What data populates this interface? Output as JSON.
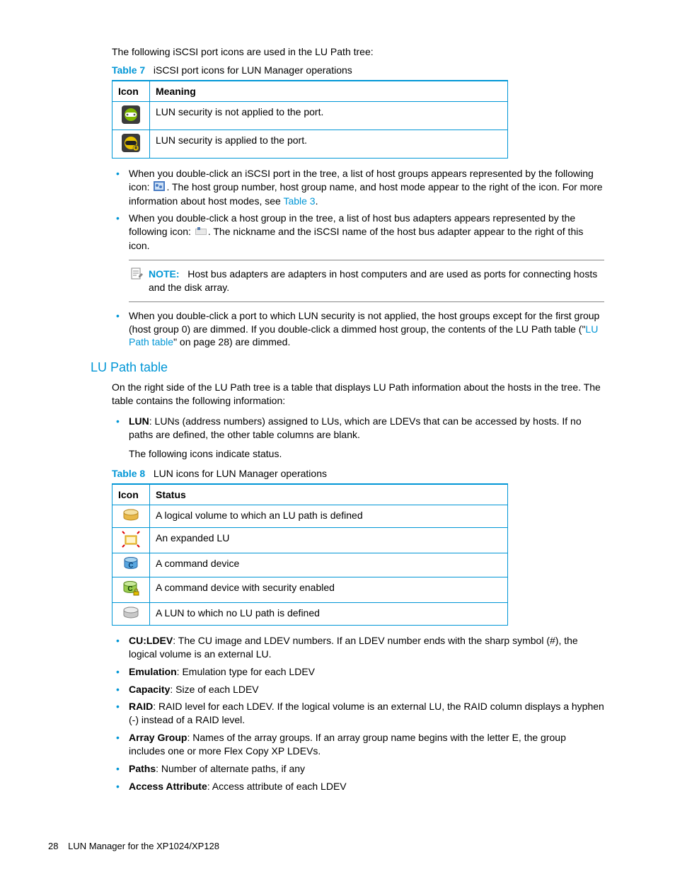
{
  "intro": "The following iSCSI port icons are used in the LU Path tree:",
  "table7": {
    "label": "Table 7",
    "title": "iSCSI port icons for LUN Manager operations",
    "headers": {
      "icon": "Icon",
      "meaning": "Meaning"
    },
    "rows": [
      {
        "meaning": "LUN security is not applied to the port."
      },
      {
        "meaning": "LUN security is applied to the port."
      }
    ]
  },
  "bullets1": {
    "b1a": "When you double-click an iSCSI port in the tree, a list of host groups appears represented by the following icon: ",
    "b1b": ". The host group number, host group name, and host mode appear to the right of the icon. For more information about host modes, see ",
    "b1link": "Table 3",
    "b2a": "When you double-click a host group in the tree, a list of host bus adapters appears represented by the following icon: ",
    "b2b": ". The nickname and the iSCSI name of the host bus adapter appear to the right of this icon."
  },
  "note": {
    "label": "NOTE:",
    "text": "Host bus adapters are adapters in host computers and are used as ports for connecting hosts and the disk array."
  },
  "bullets2": {
    "text1": "When you double-click a port to which LUN security is not applied, the host groups except for the first group (host group 0) are dimmed. If you double-click a dimmed host group, the contents of the LU Path table (\"",
    "link": "LU Path table",
    "text2": "\" on page 28) are dimmed."
  },
  "section": "LU Path table",
  "sectionP1": "On the right side of the LU Path tree is a table that displays LU Path information about the hosts in the tree. The table contains the following information:",
  "lun": {
    "term": "LUN",
    "desc": ": LUNs (address numbers) assigned to LUs, which are LDEVs that can be accessed by hosts. If no paths are defined, the other table columns are blank.",
    "after": "The following icons indicate status."
  },
  "table8": {
    "label": "Table 8",
    "title": "LUN icons for LUN Manager operations",
    "headers": {
      "icon": "Icon",
      "status": "Status"
    },
    "rows": [
      {
        "status": "A logical volume to which an LU path is defined"
      },
      {
        "status": "An expanded LU"
      },
      {
        "status": "A command device"
      },
      {
        "status": "A command device with security enabled"
      },
      {
        "status": "A LUN to which no LU path is defined"
      }
    ]
  },
  "defs": {
    "culdev": {
      "term": "CU:LDEV",
      "desc": ": The CU image and LDEV numbers. If an LDEV number ends with the sharp symbol (#), the logical volume is an external LU."
    },
    "emu": {
      "term": "Emulation",
      "desc": ": Emulation type for each LDEV"
    },
    "cap": {
      "term": "Capacity",
      "desc": ": Size of each LDEV"
    },
    "raid": {
      "term": "RAID",
      "desc": ": RAID level for each LDEV. If the logical volume is an external LU, the RAID column displays a hyphen (-) instead of a RAID level."
    },
    "ag": {
      "term": "Array Group",
      "desc": ": Names of the array groups. If an array group name begins with the letter E, the group includes one or more Flex Copy XP LDEVs."
    },
    "paths": {
      "term": "Paths",
      "desc": ": Number of alternate paths, if any"
    },
    "aa": {
      "term": "Access Attribute",
      "desc": ": Access attribute of each LDEV"
    }
  },
  "footer": {
    "page": "28",
    "title": "LUN Manager for the XP1024/XP128"
  }
}
